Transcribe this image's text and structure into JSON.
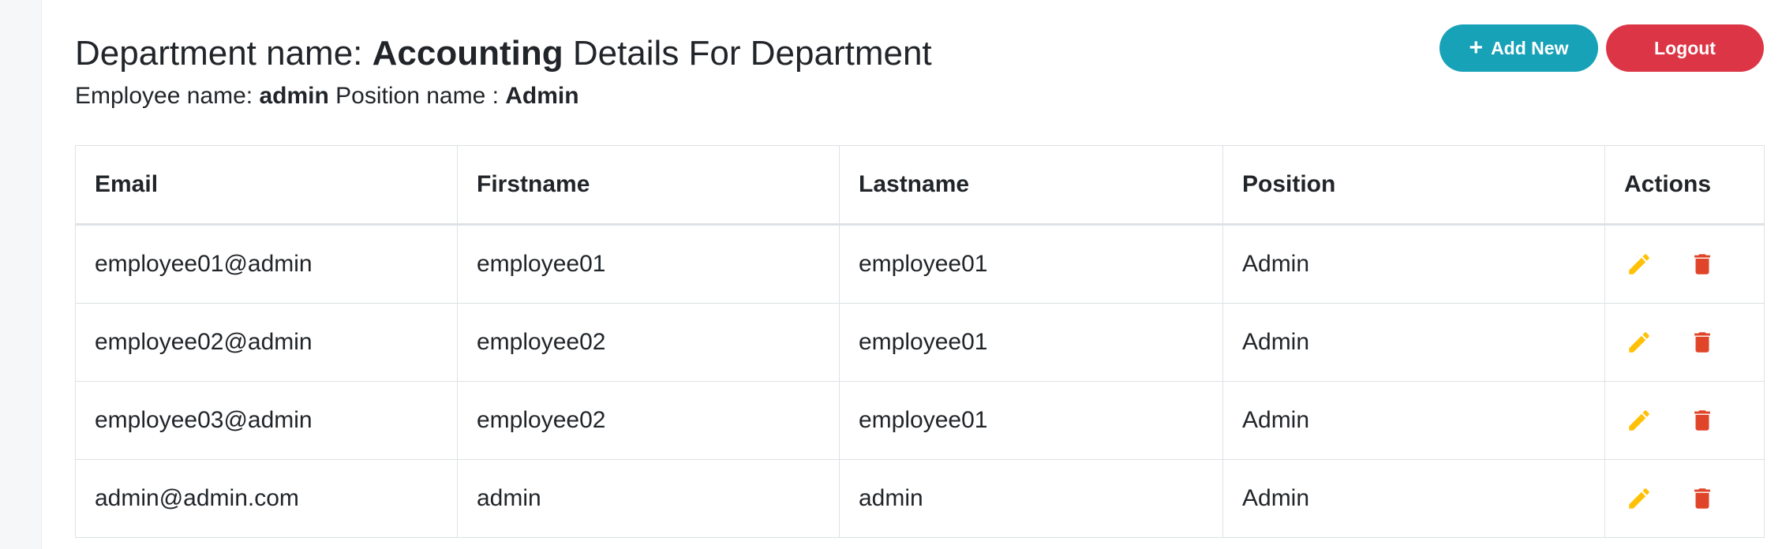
{
  "header": {
    "dept_prefix": "Department name: ",
    "dept_name": "Accounting",
    "dept_suffix": " Details For Department",
    "emp_prefix": "Employee name: ",
    "emp_name": "admin",
    "pos_prefix": " Position name : ",
    "pos_name": "Admin"
  },
  "buttons": {
    "add_new": "Add New",
    "logout": "Logout"
  },
  "table": {
    "columns": [
      "Email",
      "Firstname",
      "Lastname",
      "Position",
      "Actions"
    ],
    "rows": [
      [
        "employee01@admin",
        "employee01",
        "employee01",
        "Admin"
      ],
      [
        "employee02@admin",
        "employee02",
        "employee01",
        "Admin"
      ],
      [
        "employee03@admin",
        "employee02",
        "employee01",
        "Admin"
      ],
      [
        "admin@admin.com",
        "admin",
        "admin",
        "Admin"
      ]
    ]
  },
  "icons": {
    "edit": "pencil-icon",
    "delete": "trash-icon",
    "add": "plus-icon"
  },
  "colors": {
    "add_button": "#17a2b8",
    "logout_button": "#dc3545",
    "edit_icon": "#ffc107",
    "delete_icon": "#e0452a"
  }
}
